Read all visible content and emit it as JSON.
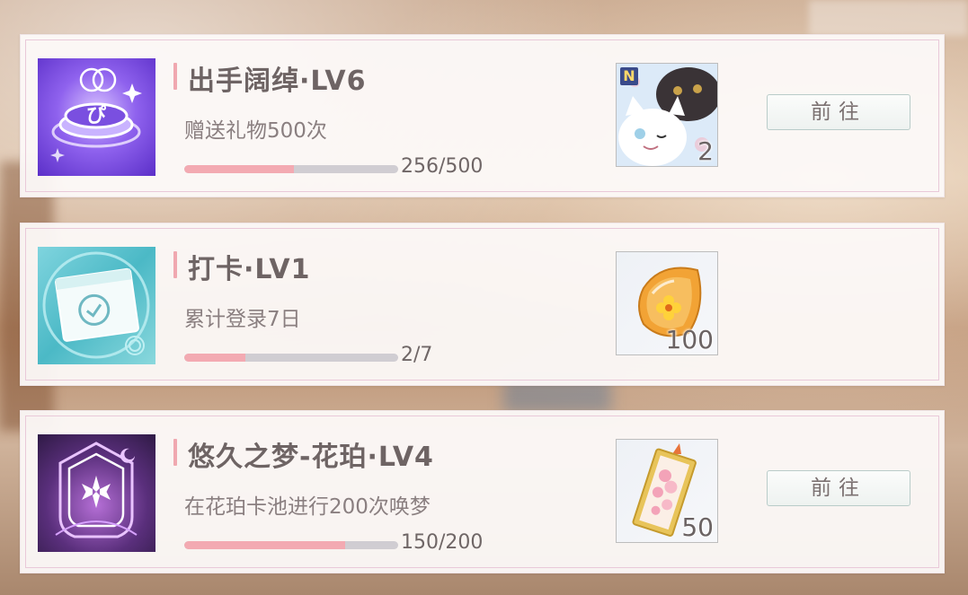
{
  "quests": [
    {
      "title": "出手阔绰·LV6",
      "description": "赠送礼物500次",
      "progress": {
        "current": 256,
        "total": 500,
        "text": "256/500"
      },
      "icon": "gift-coin-icon",
      "reward": {
        "icon": "cat-card-icon",
        "quantity": "2",
        "badge": "N"
      },
      "button_label": "前往"
    },
    {
      "title": "打卡·LV1",
      "description": "累计登录7日",
      "progress": {
        "current": 2,
        "total": 7,
        "text": "2/7"
      },
      "icon": "calendar-check-icon",
      "reward": {
        "icon": "amber-flower-icon",
        "quantity": "100"
      },
      "button_label": null
    },
    {
      "title": "悠久之梦-花珀·LV4",
      "description": "在花珀卡池进行200次唤梦",
      "progress": {
        "current": 150,
        "total": 200,
        "text": "150/200"
      },
      "icon": "dream-crest-icon",
      "reward": {
        "icon": "flower-bookmark-icon",
        "quantity": "50"
      },
      "button_label": "前往"
    }
  ],
  "colors": {
    "progress_fill": "#f3aab2",
    "progress_track": "#d0cdd2",
    "title_accent": "#f0a8b0",
    "card_border": "#e9c9d9"
  }
}
